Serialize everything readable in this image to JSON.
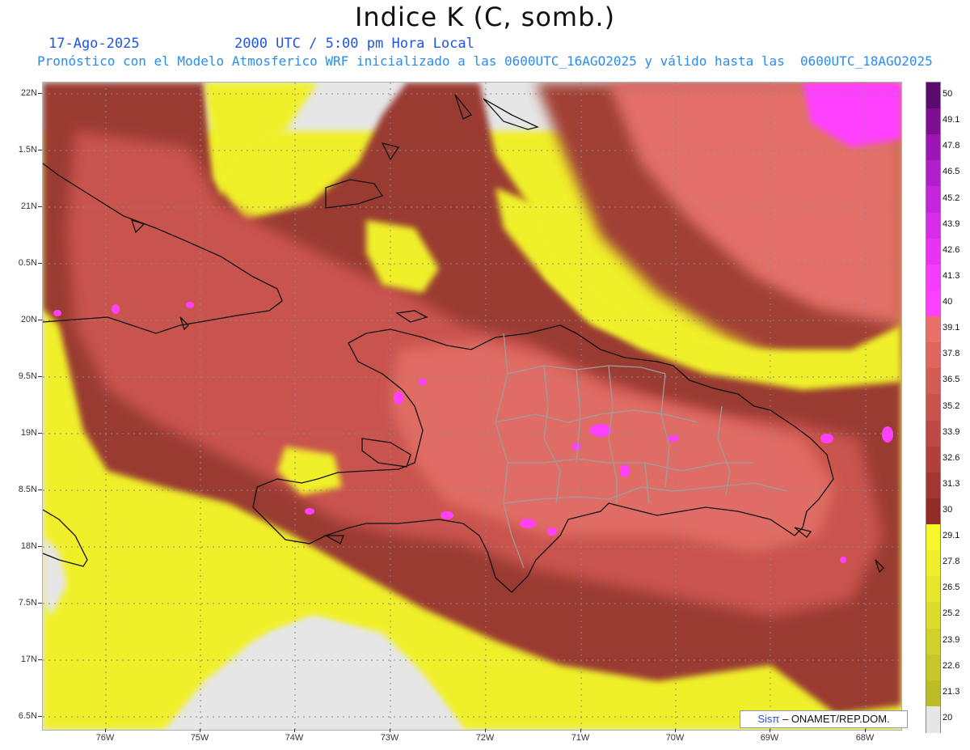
{
  "title": "Indice K (C, somb.)",
  "date": "17-Ago-2025",
  "valid_time": "2000 UTC / 5:00 pm Hora Local",
  "model_note": "Pronóstico con el Modelo Atmosferico WRF inicializado a las 0600UTC_16AGO2025 y válido hasta las  0600UTC_18AGO2025",
  "credit": {
    "brand": "Sisπ",
    "org": " – ONAMET/REP.DOM."
  },
  "lat_labels": [
    "22N",
    "1.5N",
    "21N",
    "0.5N",
    "20N",
    "9.5N",
    "19N",
    "8.5N",
    "18N",
    "7.5N",
    "17N",
    "6.5N"
  ],
  "lon_labels": [
    "76W",
    "75W",
    "74W",
    "73W",
    "72W",
    "71W",
    "70W",
    "69W",
    "68W"
  ],
  "colorbar": {
    "labels": [
      "50",
      "49.1",
      "47.8",
      "46.5",
      "45.2",
      "43.9",
      "42.6",
      "41.3",
      "40",
      "39.1",
      "37.8",
      "36.5",
      "35.2",
      "33.9",
      "32.6",
      "31.3",
      "30",
      "29.1",
      "27.8",
      "26.5",
      "25.2",
      "23.9",
      "22.6",
      "21.3",
      "20"
    ],
    "colors": [
      "#5b0a6e",
      "#7d0f91",
      "#9c16b3",
      "#b11fcb",
      "#c526dc",
      "#d72cea",
      "#e833f5",
      "#f43cfb",
      "#ff40ff",
      "#e86f6a",
      "#df6660",
      "#d45c57",
      "#c9524d",
      "#be4944",
      "#b0403b",
      "#a13632",
      "#8f2c28",
      "#f7f72a",
      "#efef2b",
      "#e6e62c",
      "#dcdc2c",
      "#d1d12c",
      "#c7c72b",
      "#bcbc29",
      "#e6e6e6"
    ]
  }
}
